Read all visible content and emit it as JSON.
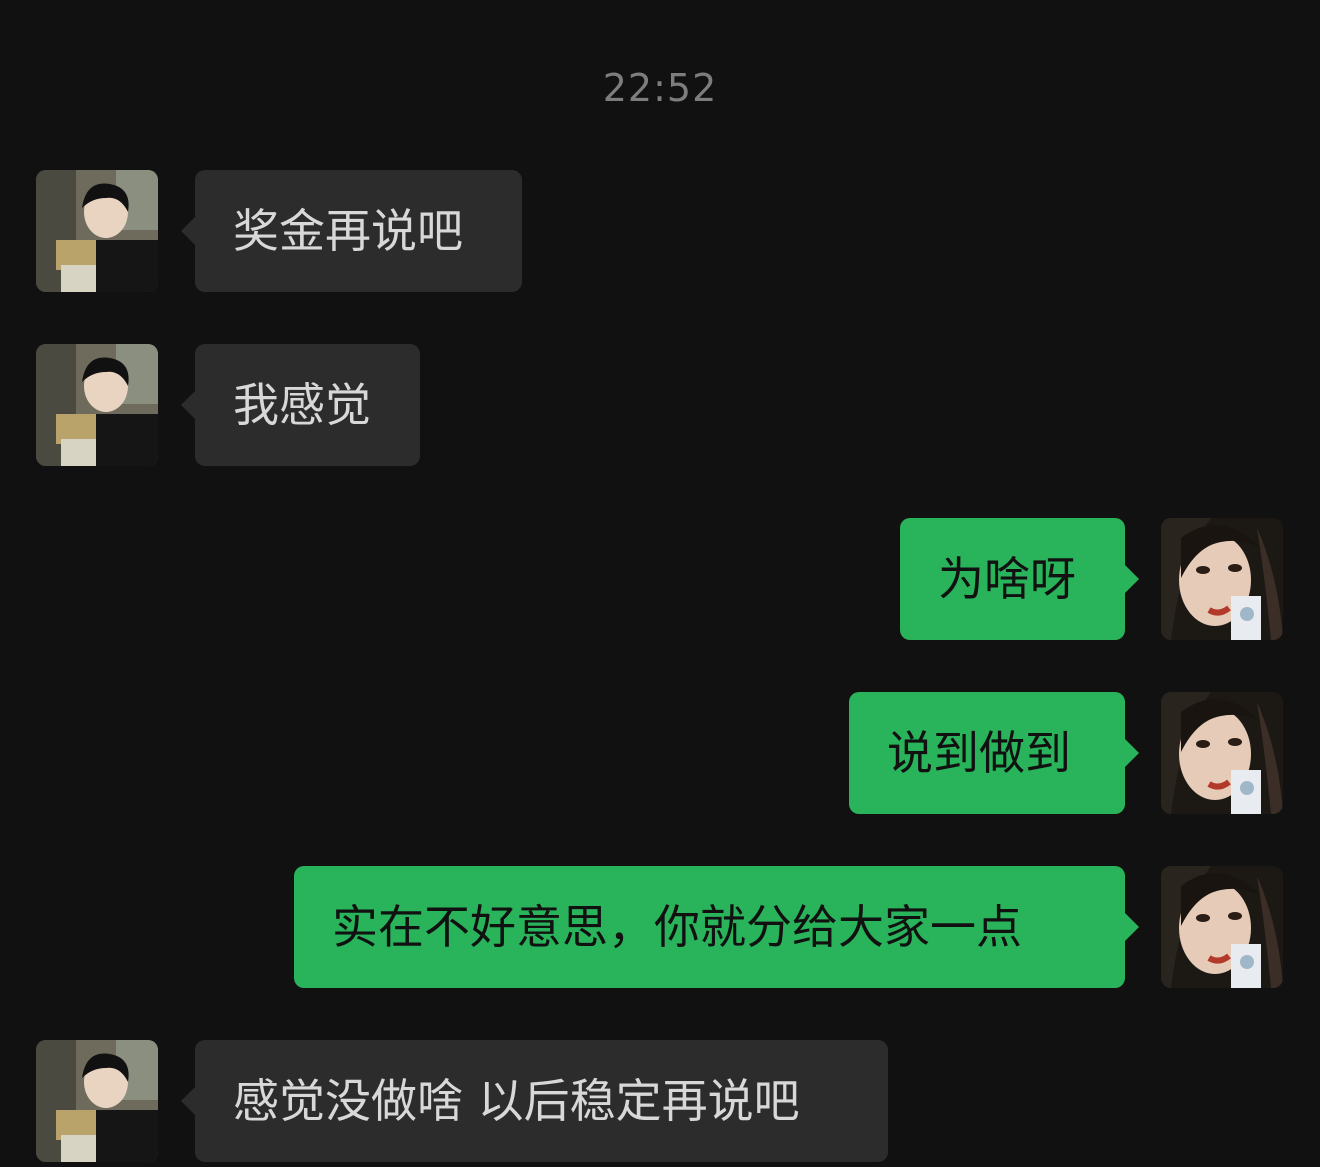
{
  "timestamp": "22:52",
  "messages": [
    {
      "direction": "incoming",
      "text": "奖金再说吧"
    },
    {
      "direction": "incoming",
      "text": "我感觉"
    },
    {
      "direction": "outgoing",
      "text": "为啥呀"
    },
    {
      "direction": "outgoing",
      "text": "说到做到"
    },
    {
      "direction": "outgoing",
      "text": "实在不好意思，你就分给大家一点"
    },
    {
      "direction": "incoming",
      "text": "感觉没做啥 以后稳定再说吧"
    }
  ],
  "colors": {
    "background": "#111111",
    "incoming_bubble": "#2c2c2c",
    "outgoing_bubble": "#29b35a",
    "timestamp_text": "#7d7d7d"
  }
}
